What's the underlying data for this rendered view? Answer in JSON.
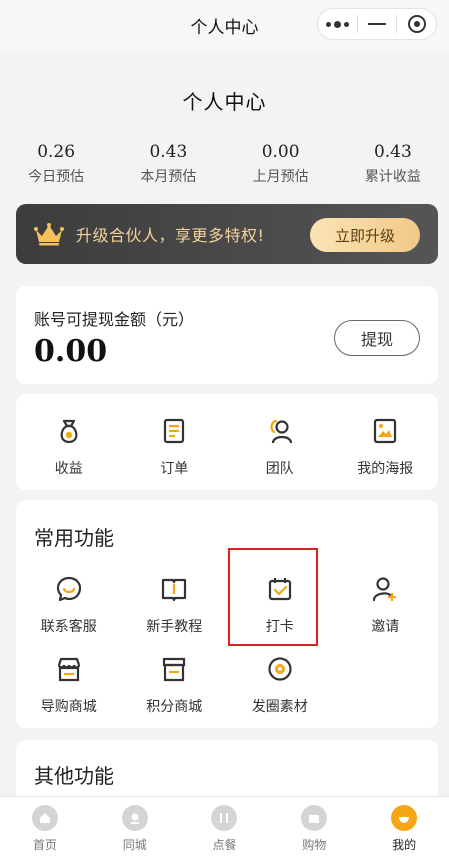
{
  "navbar": {
    "title": "个人中心"
  },
  "page": {
    "title": "个人中心"
  },
  "stats": [
    {
      "value": "0.26",
      "label": "今日预估"
    },
    {
      "value": "0.43",
      "label": "本月预估"
    },
    {
      "value": "0.00",
      "label": "上月预估"
    },
    {
      "value": "0.43",
      "label": "累计收益"
    }
  ],
  "upgrade": {
    "text": "升级合伙人，享更多特权!",
    "button": "立即升级"
  },
  "balance": {
    "label": "账号可提现金额（元）",
    "value": "0.00",
    "button": "提现"
  },
  "quick": [
    {
      "label": "收益",
      "icon": "money-bag-icon"
    },
    {
      "label": "订单",
      "icon": "order-list-icon"
    },
    {
      "label": "团队",
      "icon": "team-icon"
    },
    {
      "label": "我的海报",
      "icon": "poster-icon"
    }
  ],
  "functions": {
    "title": "常用功能",
    "items": [
      {
        "label": "联系客服",
        "icon": "chat-smile-icon"
      },
      {
        "label": "新手教程",
        "icon": "book-icon"
      },
      {
        "label": "打卡",
        "icon": "calendar-check-icon"
      },
      {
        "label": "邀请",
        "icon": "user-add-icon"
      },
      {
        "label": "导购商城",
        "icon": "shop-icon"
      },
      {
        "label": "积分商城",
        "icon": "store-icon"
      },
      {
        "label": "发圈素材",
        "icon": "aperture-icon"
      }
    ]
  },
  "other": {
    "title": "其他功能"
  },
  "tabbar": [
    {
      "label": "首页",
      "active": false
    },
    {
      "label": "同城",
      "active": false
    },
    {
      "label": "点餐",
      "active": false
    },
    {
      "label": "购物",
      "active": false
    },
    {
      "label": "我的",
      "active": true
    }
  ],
  "colors": {
    "accent": "#f4a615",
    "icon_dark": "#333333",
    "highlight_border": "#e0201f",
    "banner_text": "#f2d29c"
  }
}
